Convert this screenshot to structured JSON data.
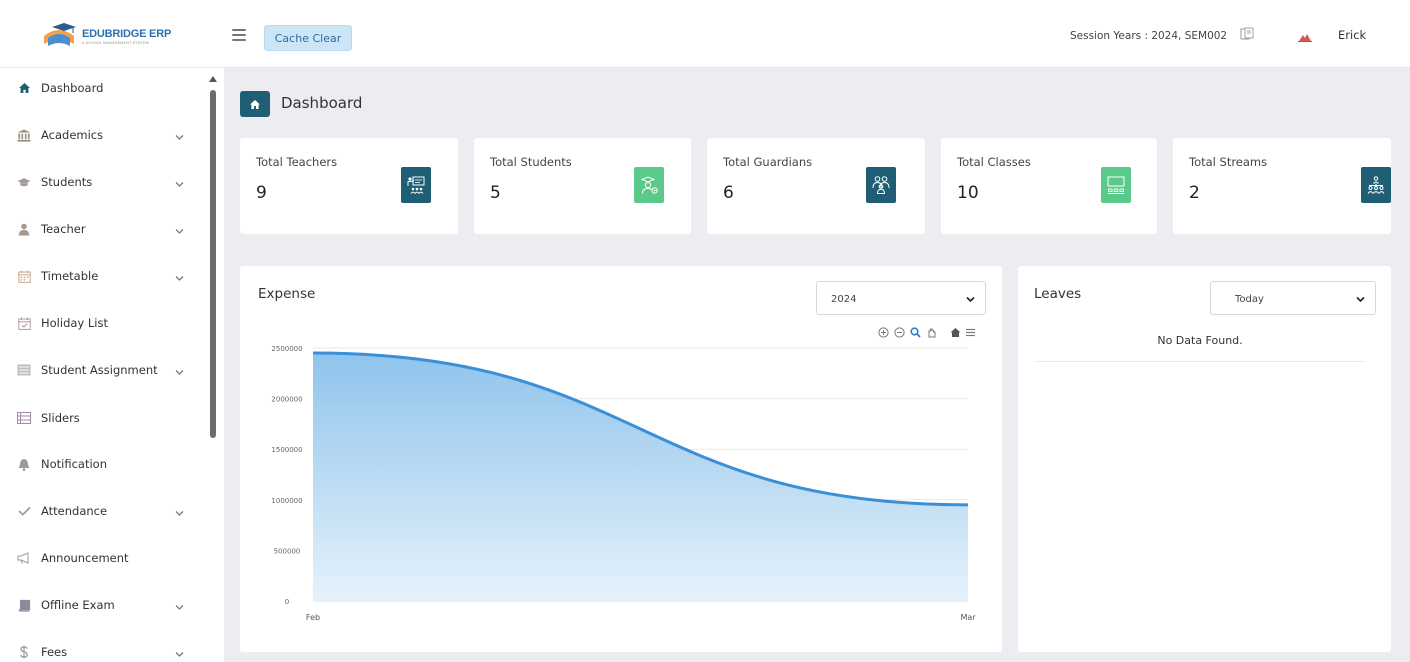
{
  "header": {
    "logo_title": "EDUBRIDGE ERP",
    "logo_subtitle": "A SCHOOL MANAGEMENT SYSTEM",
    "cache_clear_label": "Cache Clear",
    "session_text": "Session Years : 2024, SEM002",
    "user_name": "Erick"
  },
  "sidebar": {
    "items": [
      {
        "label": "Dashboard",
        "icon": "home-icon",
        "has_chevron": false
      },
      {
        "label": "Academics",
        "icon": "bank-icon",
        "has_chevron": true
      },
      {
        "label": "Students",
        "icon": "graduation-cap-icon",
        "has_chevron": true
      },
      {
        "label": "Teacher",
        "icon": "user-icon",
        "has_chevron": true
      },
      {
        "label": "Timetable",
        "icon": "calendar-icon",
        "has_chevron": true
      },
      {
        "label": "Holiday List",
        "icon": "calendar-check-icon",
        "has_chevron": false
      },
      {
        "label": "Student Assignment",
        "icon": "assignment-icon",
        "has_chevron": true
      },
      {
        "label": "Sliders",
        "icon": "list-icon",
        "has_chevron": false
      },
      {
        "label": "Notification",
        "icon": "bell-icon",
        "has_chevron": false
      },
      {
        "label": "Attendance",
        "icon": "check-icon",
        "has_chevron": true
      },
      {
        "label": "Announcement",
        "icon": "megaphone-icon",
        "has_chevron": false
      },
      {
        "label": "Offline Exam",
        "icon": "book-icon",
        "has_chevron": true
      },
      {
        "label": "Fees",
        "icon": "dollar-icon",
        "has_chevron": true
      }
    ]
  },
  "page": {
    "title": "Dashboard"
  },
  "stats": [
    {
      "label": "Total Teachers",
      "value": "9",
      "icon": "teacher-board-icon",
      "color": "#1f5e74"
    },
    {
      "label": "Total Students",
      "value": "5",
      "icon": "student-icon",
      "color": "#5bc98a"
    },
    {
      "label": "Total Guardians",
      "value": "6",
      "icon": "guardians-icon",
      "color": "#1f5e74"
    },
    {
      "label": "Total Classes",
      "value": "10",
      "icon": "classroom-icon",
      "color": "#5bc98a"
    },
    {
      "label": "Total Streams",
      "value": "2",
      "icon": "streams-icon",
      "color": "#1f5e74"
    }
  ],
  "expense": {
    "title": "Expense",
    "year_selected": "2024"
  },
  "leaves": {
    "title": "Leaves",
    "filter_selected": "Today",
    "empty_text": "No Data Found."
  },
  "chart_data": {
    "type": "area",
    "categories": [
      "Feb",
      "Mar"
    ],
    "series": [
      {
        "values": [
          2450000,
          950000
        ]
      }
    ],
    "ylim": [
      0,
      2500000
    ],
    "yticks": [
      "0",
      "500000",
      "1000000",
      "1500000",
      "2000000",
      "2500000"
    ],
    "grid": true,
    "colors": {
      "line": "#3a8fd6",
      "fill_top": "#8fc4ec",
      "fill_bottom": "#e6f2fb"
    }
  }
}
